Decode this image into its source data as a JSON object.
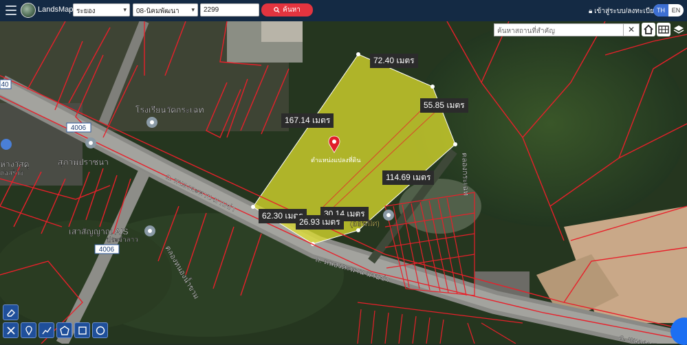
{
  "header": {
    "brand": "LandsMaps",
    "province": "ระยอง",
    "district": "08-นิคมพัฒนา",
    "parcel": "2299",
    "search_label": "ค้นหา",
    "login_label": "เข้าสู่ระบบ/ลงทะเบียน",
    "lang_th": "TH",
    "lang_en": "EN"
  },
  "map": {
    "place_search_placeholder": "ค้นหาสถานที่สำคัญ",
    "labels": {
      "school": "โรงเรียนวัดกระเฉท",
      "health": "สุภาพปราชนา",
      "store": "ห่างวัสดุ",
      "store2": "ก่อสร้าง",
      "ais": "เสาสัญญาณ AIS",
      "ais2": "ประจำลาว",
      "road1": "ถ. หนองตะพาน-มาบข่า",
      "road2": "ถ. หนองตะพาน-มาบข่า",
      "road3": "ถ. หนองตะพาน",
      "canal": "คลองกระเฉท",
      "canal2": "คลองหนองน้ำขาม",
      "route1": "4006",
      "route2": "4006",
      "route3": "40",
      "parcel_owner": "ตำแหน่งแปลงที่ดิน",
      "nearby": "(ออฟฟิศ)",
      "nearby2": "ถนนชง"
    },
    "measurements": {
      "top": "72.40 เมตร",
      "right_upper": "55.85 เมตร",
      "left_long": "167.14 เมตร",
      "right_lower": "114.69 เมตร",
      "bottom_left": "62.30 เมตร",
      "bottom_mid": "30.14 เมตร",
      "bottom_small": "26.93 เมตร"
    }
  },
  "icons": [
    "menu-icon",
    "search-icon",
    "lock-icon",
    "home-icon",
    "grid-icon",
    "layers-icon",
    "eraser-icon",
    "close-tool-icon",
    "pin-tool-icon",
    "line-tool-icon",
    "polygon-tool-icon",
    "square-tool-icon",
    "circle-tool-icon",
    "location-pin-icon"
  ],
  "colors": {
    "topbar": "#142a44",
    "parcel_fill": "#e4e42e",
    "boundary": "#e8202a",
    "search_button": "#e3343f",
    "accent": "#3d6fd3"
  }
}
